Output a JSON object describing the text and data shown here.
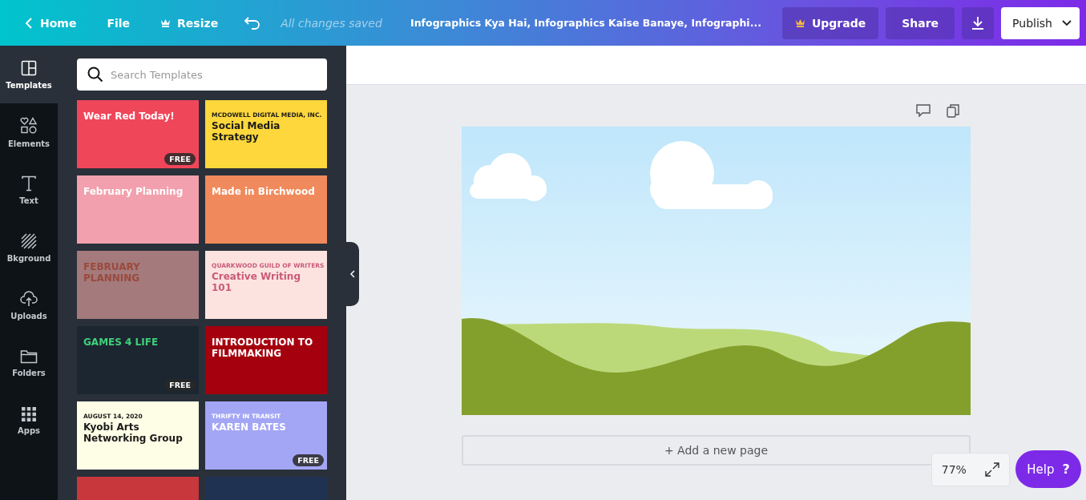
{
  "topbar": {
    "home": "Home",
    "file": "File",
    "resize": "Resize",
    "save_status": "All changes saved",
    "title": "Infographics Kya Hai, Infographics Kaise Banaye, Infographi...",
    "upgrade": "Upgrade",
    "share": "Share",
    "publish": "Publish"
  },
  "sidebar": {
    "items": [
      {
        "label": "Templates",
        "kind": "templates",
        "selected": true
      },
      {
        "label": "Elements",
        "kind": "elements",
        "selected": false
      },
      {
        "label": "Text",
        "kind": "text",
        "selected": false
      },
      {
        "label": "Bkground",
        "kind": "background",
        "selected": false
      },
      {
        "label": "Uploads",
        "kind": "uploads",
        "selected": false
      },
      {
        "label": "Folders",
        "kind": "folders",
        "selected": false
      },
      {
        "label": "Apps",
        "kind": "apps",
        "selected": false
      }
    ]
  },
  "search": {
    "placeholder": "Search Templates"
  },
  "templates": [
    {
      "title": "Wear Red Today!",
      "color": "#f0465a",
      "kind": "light",
      "badge": "FREE"
    },
    {
      "title": "Social Media Strategy",
      "subtitle": "MCDOWELL DIGITAL MEDIA, INC.",
      "color": "#fdd73c",
      "kind": "dark"
    },
    {
      "title": "February Planning",
      "color": "#f2a0ad",
      "kind": "light"
    },
    {
      "title": "Made in Birchwood",
      "color": "#f08a5c",
      "kind": "light"
    },
    {
      "title": "FEBRUARY PLANNING",
      "color": "#a47a7c",
      "kind": "brown"
    },
    {
      "title": "Creative Writing 101",
      "subtitle": "QUARKWOOD GUILD OF WRITERS",
      "color": "#fde3e0",
      "kind": "pink"
    },
    {
      "title": "GAMES 4 LIFE",
      "color": "#1c2630",
      "kind": "green",
      "badge": "FREE"
    },
    {
      "title": "INTRODUCTION TO FILMMAKING",
      "color": "#a5000e",
      "kind": "light"
    },
    {
      "title": "Kyobi Arts Networking Group",
      "subtitle": "AUGUST 14, 2020",
      "color": "#fefde6",
      "kind": "dark"
    },
    {
      "title": "KAREN BATES",
      "subtitle": "THRIFTY IN TRANSIT",
      "color": "#a3a6f5",
      "kind": "light",
      "badge": "FREE"
    },
    {
      "color": "#c8373c",
      "kind": "light"
    },
    {
      "color": "#1f3252",
      "kind": "light"
    }
  ],
  "canvas": {
    "add_page": "+ Add a new page"
  },
  "zoom": {
    "value": "77%"
  },
  "help": {
    "label": "Help",
    "mark": "?"
  }
}
